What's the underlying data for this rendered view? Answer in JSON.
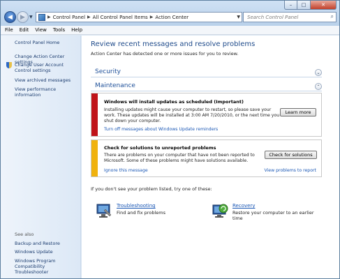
{
  "window": {
    "controls": {
      "minimize": "–",
      "maximize": "□",
      "close": "✕"
    }
  },
  "nav": {
    "back_icon": "back-arrow-icon",
    "forward_icon": "forward-arrow-icon"
  },
  "address": {
    "segments": [
      "Control Panel",
      "All Control Panel Items",
      "Action Center"
    ]
  },
  "search": {
    "placeholder": "Search Control Panel"
  },
  "menu": [
    "File",
    "Edit",
    "View",
    "Tools",
    "Help"
  ],
  "sidebar": {
    "home": "Control Panel Home",
    "links": [
      "Change Action Center settings",
      "Change User Account Control settings",
      "View archived messages",
      "View performance information"
    ],
    "see_also": {
      "heading": "See also",
      "links": [
        "Backup and Restore",
        "Windows Update",
        "Windows Program Compatibility Troubleshooter"
      ]
    }
  },
  "main": {
    "title": "Review recent messages and resolve problems",
    "subtitle": "Action Center has detected one or more issues for you to review.",
    "sections": [
      "Security",
      "Maintenance"
    ],
    "alerts": [
      {
        "title": "Windows will install updates as scheduled  (Important)",
        "body": "Installing updates might cause your computer to restart, so please save your work. These updates will be installed at 3:00 AM 7/20/2010, or the next time you shut down your computer.",
        "link": "Turn off messages about Windows Update reminders",
        "button": "Learn more",
        "color": "#c0141a"
      },
      {
        "title": "Check for solutions to unreported problems",
        "body": "There are problems on your computer that have not been reported to Microsoft. Some of these problems might have solutions available.",
        "link": "Ignore this message",
        "link2": "View problems to report",
        "button": "Check for solutions",
        "color": "#f0b20e"
      }
    ],
    "tried_text": "If you don't see your problem listed, try one of these:",
    "tools": [
      {
        "name": "Troubleshooting",
        "desc": "Find and fix problems"
      },
      {
        "name": "Recovery",
        "desc": "Restore your computer to an earlier time"
      }
    ]
  }
}
